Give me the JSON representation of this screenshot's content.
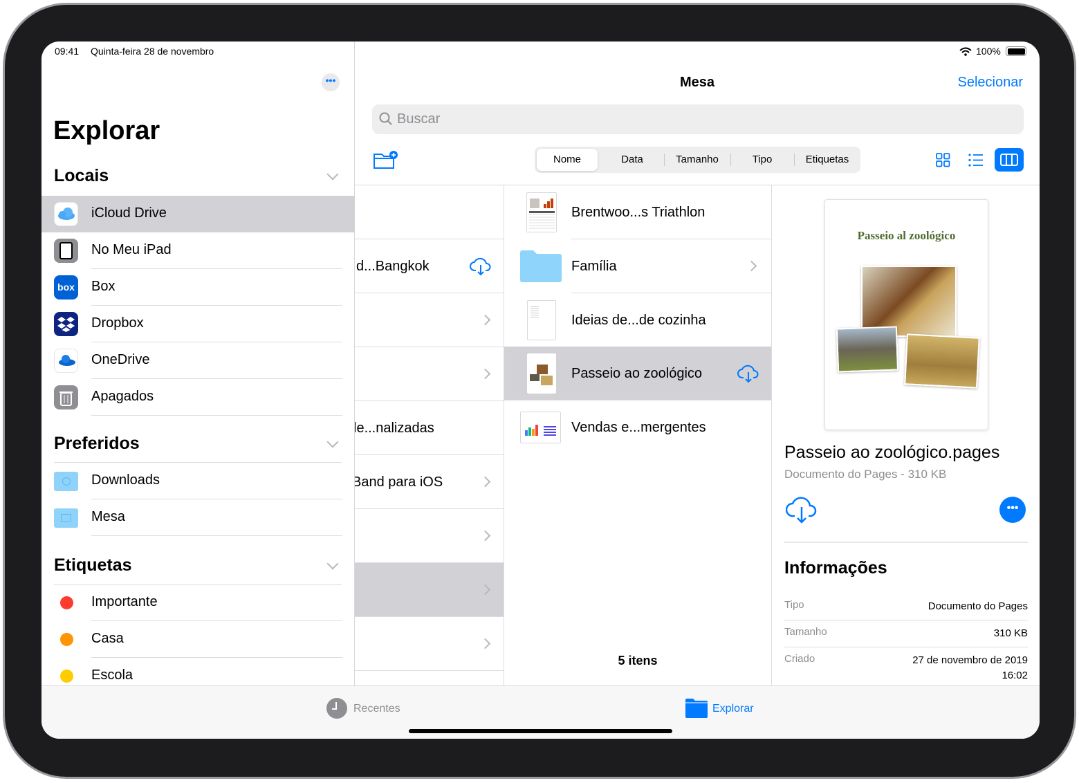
{
  "status_bar": {
    "time": "09:41",
    "date": "Quinta-feira 28 de novembro",
    "battery": "100%"
  },
  "sidebar": {
    "title": "Explorar",
    "sections": [
      {
        "title": "Locais",
        "items": [
          {
            "label": "iCloud Drive",
            "icon": "icloud-icon",
            "selected": true
          },
          {
            "label": "No Meu iPad",
            "icon": "ipad-icon"
          },
          {
            "label": "Box",
            "icon": "box-icon",
            "icon_text": "box"
          },
          {
            "label": "Dropbox",
            "icon": "dropbox-icon"
          },
          {
            "label": "OneDrive",
            "icon": "onedrive-icon"
          },
          {
            "label": "Apagados",
            "icon": "trash-icon"
          }
        ]
      },
      {
        "title": "Preferidos",
        "items": [
          {
            "label": "Downloads",
            "icon": "folder-download-icon"
          },
          {
            "label": "Mesa",
            "icon": "folder-desktop-icon"
          }
        ]
      },
      {
        "title": "Etiquetas",
        "items": [
          {
            "label": "Importante",
            "color": "#ff3b30"
          },
          {
            "label": "Casa",
            "color": "#ff9500"
          },
          {
            "label": "Escola",
            "color": "#ffcc00"
          }
        ]
      }
    ]
  },
  "header": {
    "title": "Mesa",
    "select_label": "Selecionar",
    "search_placeholder": "Buscar"
  },
  "sort": {
    "options": [
      "Nome",
      "Data",
      "Tamanho",
      "Tipo",
      "Etiquetas"
    ],
    "selected": "Nome"
  },
  "view_modes": {
    "options": [
      "icons",
      "list",
      "columns"
    ],
    "selected": "columns"
  },
  "column1": {
    "rows": [
      {
        "label": ""
      },
      {
        "label": "d...Bangkok",
        "cloud": true
      },
      {
        "label": "",
        "chevron": true
      },
      {
        "label": "",
        "chevron": true
      },
      {
        "label": "le...nalizadas"
      },
      {
        "label": "Band para iOS",
        "chevron": true
      },
      {
        "label": "",
        "chevron": true
      },
      {
        "label": "",
        "chevron": true,
        "selected": true
      },
      {
        "label": "",
        "chevron": true
      }
    ]
  },
  "column2": {
    "rows": [
      {
        "label": "Brentwoo...s Triathlon",
        "type": "spreadsheet"
      },
      {
        "label": "Família",
        "type": "folder",
        "chevron": true
      },
      {
        "label": "Ideias de...de cozinha",
        "type": "document"
      },
      {
        "label": "Passeio ao zoológico",
        "type": "pages",
        "cloud": true,
        "selected": true
      },
      {
        "label": "Vendas e...mergentes",
        "type": "chart-doc"
      }
    ],
    "count": "5 itens"
  },
  "preview": {
    "doc_title": "Passeio al zoológico",
    "filename": "Passeio ao zoológico.pages",
    "subtitle": "Documento do Pages - 310 KB",
    "info_title": "Informações",
    "info": [
      {
        "key": "Tipo",
        "value": "Documento do Pages"
      },
      {
        "key": "Tamanho",
        "value": "310 KB"
      },
      {
        "key": "Criado",
        "value": "27 de novembro de 2019",
        "value2": "16:02"
      }
    ]
  },
  "tabbar": {
    "items": [
      {
        "label": "Recentes",
        "active": false
      },
      {
        "label": "Explorar",
        "active": true
      }
    ]
  },
  "colors": {
    "accent": "#007aff",
    "selection": "#d1d1d6"
  }
}
